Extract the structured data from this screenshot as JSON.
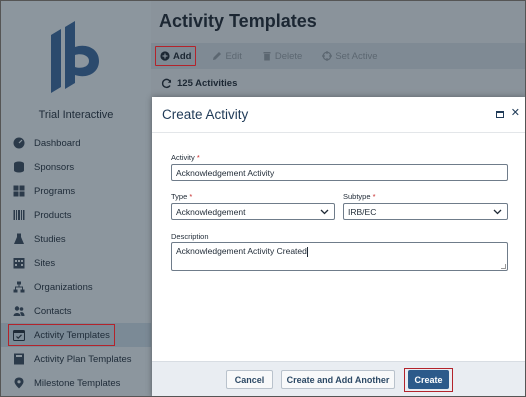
{
  "app": {
    "brand": "Trial Interactive",
    "brand_color": "#2b4a6d"
  },
  "sidebar": {
    "items": [
      {
        "label": "Dashboard",
        "icon": "dashboard-icon"
      },
      {
        "label": "Sponsors",
        "icon": "database-icon"
      },
      {
        "label": "Programs",
        "icon": "grid-icon"
      },
      {
        "label": "Products",
        "icon": "barcode-icon"
      },
      {
        "label": "Studies",
        "icon": "flask-icon"
      },
      {
        "label": "Sites",
        "icon": "building-icon"
      },
      {
        "label": "Organizations",
        "icon": "sitemap-icon"
      },
      {
        "label": "Contacts",
        "icon": "users-icon"
      },
      {
        "label": "Activity Templates",
        "icon": "calendar-check-icon",
        "active": true
      },
      {
        "label": "Activity Plan Templates",
        "icon": "book-icon"
      },
      {
        "label": "Milestone Templates",
        "icon": "map-marker-icon"
      }
    ]
  },
  "header": {
    "title": "Activity Templates"
  },
  "toolbar": {
    "add_label": "Add",
    "edit_label": "Edit",
    "delete_label": "Delete",
    "set_active_label": "Set Active"
  },
  "summary": {
    "count_label": "125 Activities"
  },
  "modal": {
    "title": "Create Activity",
    "activity_label": "Activity",
    "activity_value": "Acknowledgement Activity",
    "type_label": "Type",
    "type_value": "Acknowledgement",
    "subtype_label": "Subtype",
    "subtype_value": "IRB/EC",
    "description_label": "Description",
    "description_value": "Acknowledgement Activity Created",
    "required_mark": "*",
    "cancel_label": "Cancel",
    "create_add_another_label": "Create and Add Another",
    "create_label": "Create"
  },
  "colors": {
    "highlight": "#b3232b",
    "primary_button": "#2c5a8a",
    "required": "#c62828"
  }
}
